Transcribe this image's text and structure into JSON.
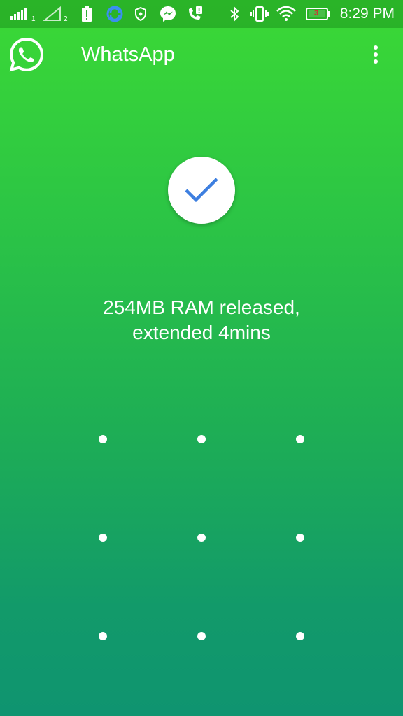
{
  "status_bar": {
    "sim1_label": "1",
    "sim2_label": "2",
    "battery_level": "3",
    "time": "8:29 PM",
    "icons": [
      "signal-sim1-icon",
      "signal-sim2-icon",
      "battery-alert-icon",
      "sync-icon",
      "shield-icon",
      "messenger-icon",
      "call-alert-icon",
      "bluetooth-icon",
      "vibrate-icon",
      "wifi-icon",
      "battery-icon"
    ]
  },
  "app_bar": {
    "title": "WhatsApp",
    "logo_icon": "whatsapp-logo-icon",
    "menu_icon": "more-vert-icon"
  },
  "main": {
    "status_icon": "check-icon",
    "message_line1": "254MB RAM released,",
    "message_line2": "extended 4mins"
  },
  "pattern": {
    "rows": 3,
    "cols": 3
  },
  "colors": {
    "gradient_top": "#3bd935",
    "gradient_bottom": "#0f9470",
    "check_color": "#3d7fe0",
    "text": "#ffffff"
  }
}
